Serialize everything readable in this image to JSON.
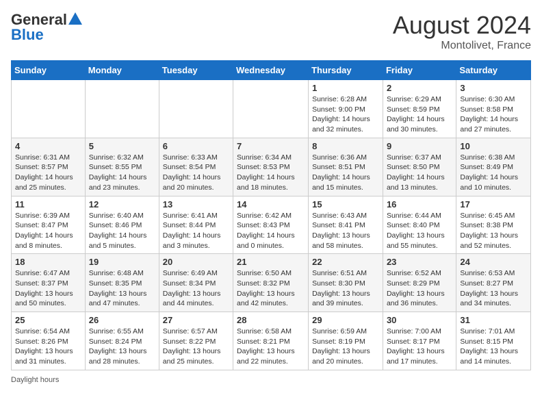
{
  "header": {
    "logo_general": "General",
    "logo_blue": "Blue",
    "month_title": "August 2024",
    "location": "Montolivet, France"
  },
  "days_of_week": [
    "Sunday",
    "Monday",
    "Tuesday",
    "Wednesday",
    "Thursday",
    "Friday",
    "Saturday"
  ],
  "weeks": [
    [
      {
        "day": "",
        "info": ""
      },
      {
        "day": "",
        "info": ""
      },
      {
        "day": "",
        "info": ""
      },
      {
        "day": "",
        "info": ""
      },
      {
        "day": "1",
        "info": "Sunrise: 6:28 AM\nSunset: 9:00 PM\nDaylight: 14 hours and 32 minutes."
      },
      {
        "day": "2",
        "info": "Sunrise: 6:29 AM\nSunset: 8:59 PM\nDaylight: 14 hours and 30 minutes."
      },
      {
        "day": "3",
        "info": "Sunrise: 6:30 AM\nSunset: 8:58 PM\nDaylight: 14 hours and 27 minutes."
      }
    ],
    [
      {
        "day": "4",
        "info": "Sunrise: 6:31 AM\nSunset: 8:57 PM\nDaylight: 14 hours and 25 minutes."
      },
      {
        "day": "5",
        "info": "Sunrise: 6:32 AM\nSunset: 8:55 PM\nDaylight: 14 hours and 23 minutes."
      },
      {
        "day": "6",
        "info": "Sunrise: 6:33 AM\nSunset: 8:54 PM\nDaylight: 14 hours and 20 minutes."
      },
      {
        "day": "7",
        "info": "Sunrise: 6:34 AM\nSunset: 8:53 PM\nDaylight: 14 hours and 18 minutes."
      },
      {
        "day": "8",
        "info": "Sunrise: 6:36 AM\nSunset: 8:51 PM\nDaylight: 14 hours and 15 minutes."
      },
      {
        "day": "9",
        "info": "Sunrise: 6:37 AM\nSunset: 8:50 PM\nDaylight: 14 hours and 13 minutes."
      },
      {
        "day": "10",
        "info": "Sunrise: 6:38 AM\nSunset: 8:49 PM\nDaylight: 14 hours and 10 minutes."
      }
    ],
    [
      {
        "day": "11",
        "info": "Sunrise: 6:39 AM\nSunset: 8:47 PM\nDaylight: 14 hours and 8 minutes."
      },
      {
        "day": "12",
        "info": "Sunrise: 6:40 AM\nSunset: 8:46 PM\nDaylight: 14 hours and 5 minutes."
      },
      {
        "day": "13",
        "info": "Sunrise: 6:41 AM\nSunset: 8:44 PM\nDaylight: 14 hours and 3 minutes."
      },
      {
        "day": "14",
        "info": "Sunrise: 6:42 AM\nSunset: 8:43 PM\nDaylight: 14 hours and 0 minutes."
      },
      {
        "day": "15",
        "info": "Sunrise: 6:43 AM\nSunset: 8:41 PM\nDaylight: 13 hours and 58 minutes."
      },
      {
        "day": "16",
        "info": "Sunrise: 6:44 AM\nSunset: 8:40 PM\nDaylight: 13 hours and 55 minutes."
      },
      {
        "day": "17",
        "info": "Sunrise: 6:45 AM\nSunset: 8:38 PM\nDaylight: 13 hours and 52 minutes."
      }
    ],
    [
      {
        "day": "18",
        "info": "Sunrise: 6:47 AM\nSunset: 8:37 PM\nDaylight: 13 hours and 50 minutes."
      },
      {
        "day": "19",
        "info": "Sunrise: 6:48 AM\nSunset: 8:35 PM\nDaylight: 13 hours and 47 minutes."
      },
      {
        "day": "20",
        "info": "Sunrise: 6:49 AM\nSunset: 8:34 PM\nDaylight: 13 hours and 44 minutes."
      },
      {
        "day": "21",
        "info": "Sunrise: 6:50 AM\nSunset: 8:32 PM\nDaylight: 13 hours and 42 minutes."
      },
      {
        "day": "22",
        "info": "Sunrise: 6:51 AM\nSunset: 8:30 PM\nDaylight: 13 hours and 39 minutes."
      },
      {
        "day": "23",
        "info": "Sunrise: 6:52 AM\nSunset: 8:29 PM\nDaylight: 13 hours and 36 minutes."
      },
      {
        "day": "24",
        "info": "Sunrise: 6:53 AM\nSunset: 8:27 PM\nDaylight: 13 hours and 34 minutes."
      }
    ],
    [
      {
        "day": "25",
        "info": "Sunrise: 6:54 AM\nSunset: 8:26 PM\nDaylight: 13 hours and 31 minutes."
      },
      {
        "day": "26",
        "info": "Sunrise: 6:55 AM\nSunset: 8:24 PM\nDaylight: 13 hours and 28 minutes."
      },
      {
        "day": "27",
        "info": "Sunrise: 6:57 AM\nSunset: 8:22 PM\nDaylight: 13 hours and 25 minutes."
      },
      {
        "day": "28",
        "info": "Sunrise: 6:58 AM\nSunset: 8:21 PM\nDaylight: 13 hours and 22 minutes."
      },
      {
        "day": "29",
        "info": "Sunrise: 6:59 AM\nSunset: 8:19 PM\nDaylight: 13 hours and 20 minutes."
      },
      {
        "day": "30",
        "info": "Sunrise: 7:00 AM\nSunset: 8:17 PM\nDaylight: 13 hours and 17 minutes."
      },
      {
        "day": "31",
        "info": "Sunrise: 7:01 AM\nSunset: 8:15 PM\nDaylight: 13 hours and 14 minutes."
      }
    ]
  ],
  "footer": {
    "daylight_label": "Daylight hours"
  }
}
